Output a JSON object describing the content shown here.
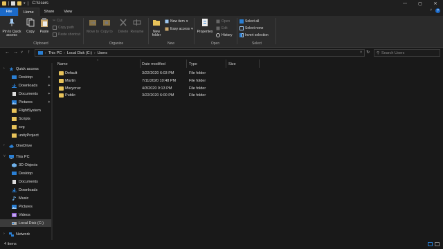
{
  "window": {
    "title": "C:\\Users",
    "controls": [
      "—",
      "▢",
      "✕"
    ]
  },
  "tabs": {
    "file": "File",
    "home": "Home",
    "share": "Share",
    "view": "View"
  },
  "ribbon": {
    "clipboard": {
      "label": "Clipboard",
      "pin": "Pin to Quick access",
      "copy": "Copy",
      "paste": "Paste",
      "cut": "Cut",
      "copy_path": "Copy path",
      "paste_shortcut": "Paste shortcut"
    },
    "organize": {
      "label": "Organize",
      "move_to": "Move to",
      "copy_to": "Copy to",
      "delete": "Delete",
      "rename": "Rename"
    },
    "new": {
      "label": "New",
      "new_folder": "New folder",
      "new_item": "New item",
      "easy_access": "Easy access"
    },
    "open": {
      "label": "Open",
      "properties": "Properties",
      "open": "Open",
      "edit": "Edit",
      "history": "History"
    },
    "select": {
      "label": "Select",
      "select_all": "Select all",
      "select_none": "Select none",
      "invert_selection": "Invert selection"
    }
  },
  "address": {
    "crumbs": [
      "This PC",
      "Local Disk (C:)",
      "Users"
    ],
    "search_placeholder": "Search Users"
  },
  "sidebar": {
    "quick_access": "Quick access",
    "quick_items": [
      "Desktop",
      "Downloads",
      "Documents",
      "Pictures",
      "FlightSystem",
      "Scripts",
      "svg",
      "unityProject"
    ],
    "onedrive": "OneDrive",
    "this_pc": "This PC",
    "pc_items": [
      "3D Objects",
      "Desktop",
      "Documents",
      "Downloads",
      "Music",
      "Pictures",
      "Videos",
      "Local Disk (C:)"
    ],
    "network": "Network"
  },
  "columns": {
    "name": "Name",
    "date": "Date modified",
    "type": "Type",
    "size": "Size"
  },
  "files": [
    {
      "name": "Default",
      "date": "3/22/2020 6:03 PM",
      "type": "File folder"
    },
    {
      "name": "Martin",
      "date": "7/11/2020 10:48 PM",
      "type": "File folder"
    },
    {
      "name": "Marycruz",
      "date": "4/3/2020 9:13 PM",
      "type": "File folder"
    },
    {
      "name": "Public",
      "date": "3/22/2020 6:00 PM",
      "type": "File folder"
    }
  ],
  "status": {
    "count": "4 items"
  },
  "colors": {
    "accent": "#1b6ac9",
    "folder": "#e8c35a",
    "background": "#191919",
    "ribbon": "#2b2b2b"
  }
}
